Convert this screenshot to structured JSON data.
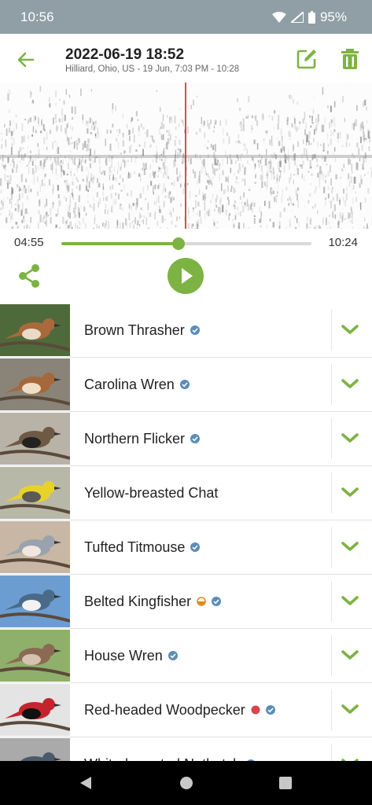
{
  "status_bar": {
    "time": "10:56",
    "battery": "95%"
  },
  "header": {
    "title": "2022-06-19 18:52",
    "subtitle": "Hilliard, Ohio, US - 19 Jun, 7:03 PM - 10:28"
  },
  "player": {
    "current_time": "04:55",
    "total_time": "10:24",
    "progress_fraction": 0.47
  },
  "colors": {
    "accent": "#7cb342",
    "verified": "#5b8db8",
    "cursor": "#c62828"
  },
  "species": [
    {
      "name": "Brown Thrasher",
      "extra_badge": ""
    },
    {
      "name": "Carolina Wren",
      "extra_badge": ""
    },
    {
      "name": "Northern Flicker",
      "extra_badge": ""
    },
    {
      "name": "Yellow-breasted Chat",
      "extra_badge": "none"
    },
    {
      "name": "Tufted Titmouse",
      "extra_badge": ""
    },
    {
      "name": "Belted Kingfisher",
      "extra_badge": "half-circle-orange"
    },
    {
      "name": "House Wren",
      "extra_badge": ""
    },
    {
      "name": "Red-headed Woodpecker",
      "extra_badge": "dot-red"
    },
    {
      "name": "White-breasted Nuthatch",
      "extra_badge": ""
    }
  ]
}
